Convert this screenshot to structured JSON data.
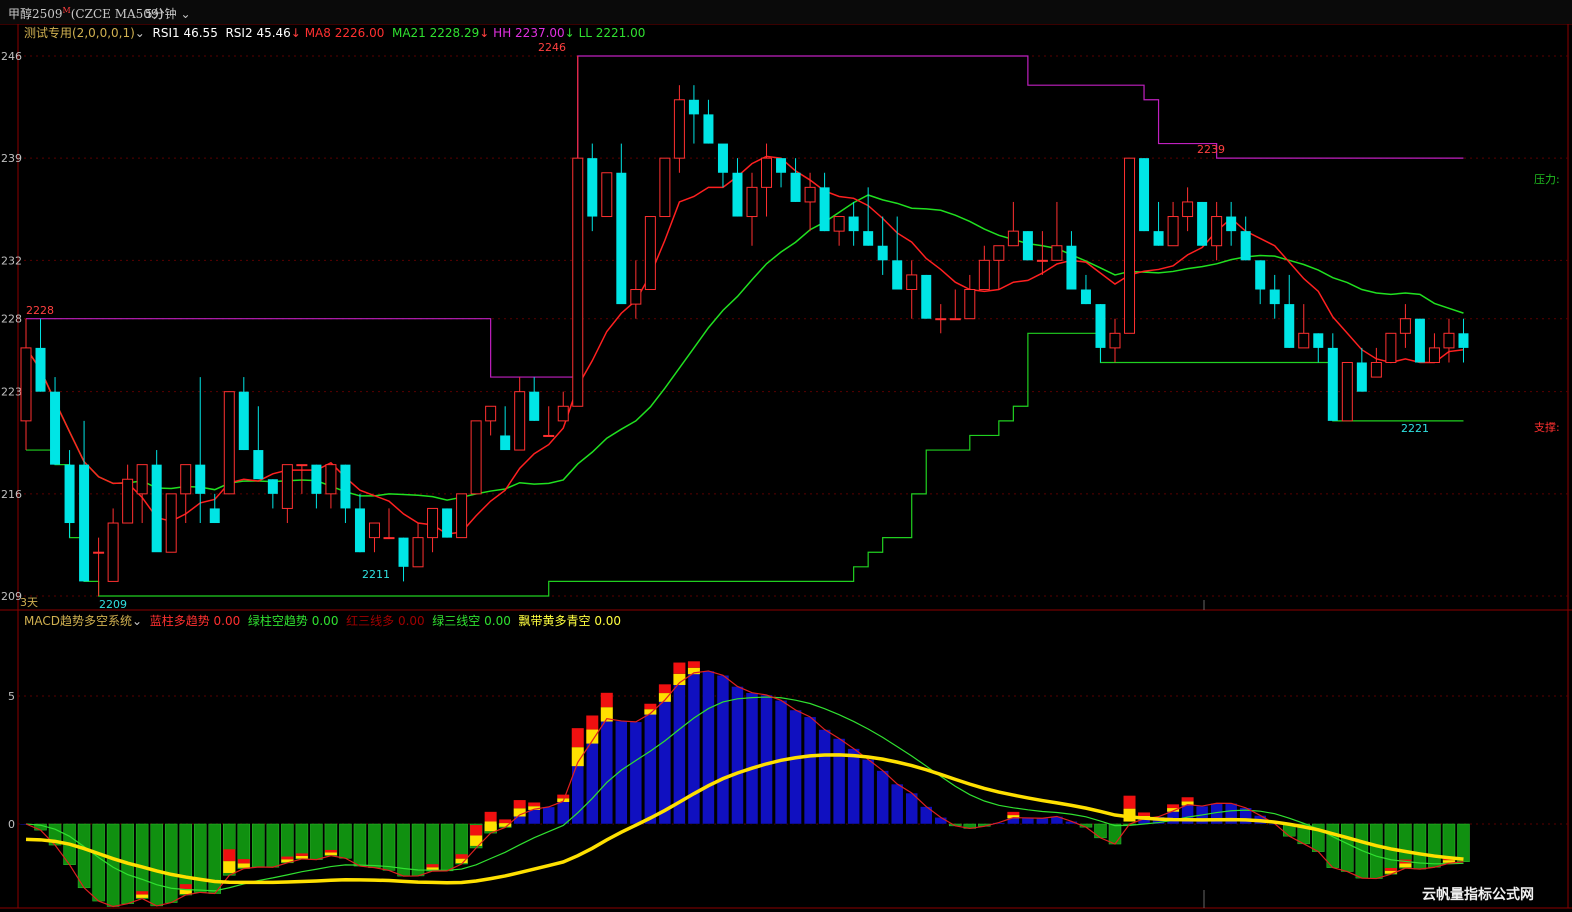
{
  "titlebar": {
    "symbol": "甲醇2509",
    "symbol_sup": "M",
    "contract": "(CZCE MA509)",
    "period": "5分钟"
  },
  "upper": {
    "indicator_name": "测试专用(2,0,0,0,1)",
    "rsi1_label": "RSI1",
    "rsi1": "46.55",
    "rsi2_label": "RSI2",
    "rsi2": "45.46",
    "ma8_label": "MA8",
    "ma8": "2226.00",
    "ma21_label": "MA21",
    "ma21": "2228.29",
    "hh_label": "HH",
    "hh": "2237.00",
    "ll_label": "LL",
    "ll": "2221.00",
    "axis_ticks": [
      "246",
      "239",
      "232",
      "228",
      "223",
      "216",
      "209"
    ],
    "high_marks": [
      "2228",
      "2246",
      "2239"
    ],
    "low_marks": [
      "2209",
      "2211",
      "2221"
    ],
    "pressure_label": "压力:",
    "support_label": "支撑:",
    "days_label": "3天"
  },
  "lower": {
    "indicator_name": "MACD趋势多空系统",
    "blue_label": "蓝柱多趋势",
    "blue_val": "0.00",
    "green_label": "绿柱空趋势",
    "green_val": "0.00",
    "red3_label": "红三线多",
    "red3_val": "0.00",
    "green3_label": "绿三线空",
    "green3_val": "0.00",
    "ribbon_label": "飘带黄多青空",
    "ribbon_val": "0.00",
    "axis_ticks": [
      "5",
      "0"
    ]
  },
  "watermark": "云帆量指标公式网",
  "colors": {
    "up": "#ff3030",
    "down": "#00e5e5",
    "ma8": "#ff2020",
    "ma21": "#20e020",
    "hh": "#c020c0",
    "ll": "#20d020"
  },
  "chart_data": [
    {
      "type": "candlestick",
      "title": "甲醇2509 5分钟",
      "ylim": [
        2209,
        2246
      ],
      "ohlc": [
        [
          2221,
          2228,
          2219,
          2226
        ],
        [
          2226,
          2228,
          2223,
          2223
        ],
        [
          2223,
          2224,
          2218,
          2218
        ],
        [
          2218,
          2219,
          2213,
          2214
        ],
        [
          2218,
          2221,
          2210,
          2210
        ],
        [
          2212,
          2213,
          2209,
          2212
        ],
        [
          2210,
          2215,
          2210,
          2214
        ],
        [
          2214,
          2218,
          2214,
          2217
        ],
        [
          2216,
          2218,
          2214,
          2218
        ],
        [
          2218,
          2219,
          2214,
          2212
        ],
        [
          2212,
          2216,
          2212,
          2216
        ],
        [
          2216,
          2218,
          2214,
          2218
        ],
        [
          2218,
          2224,
          2214,
          2216
        ],
        [
          2215,
          2216,
          2214,
          2214
        ],
        [
          2216,
          2223,
          2216,
          2223
        ],
        [
          2223,
          2224,
          2219,
          2219
        ],
        [
          2219,
          2222,
          2217,
          2217
        ],
        [
          2217,
          2217,
          2215,
          2216
        ],
        [
          2215,
          2218,
          2214,
          2218
        ],
        [
          2218,
          2218,
          2216,
          2218
        ],
        [
          2218,
          2218,
          2215,
          2216
        ],
        [
          2216,
          2218,
          2215,
          2218
        ],
        [
          2218,
          2218,
          2214,
          2215
        ],
        [
          2215,
          2216,
          2212,
          2212
        ],
        [
          2213,
          2214,
          2212,
          2214
        ],
        [
          2213,
          2215,
          2213,
          2213
        ],
        [
          2213,
          2213,
          2210,
          2211
        ],
        [
          2211,
          2214,
          2211,
          2213
        ],
        [
          2213,
          2215,
          2212,
          2215
        ],
        [
          2215,
          2215,
          2213,
          2213
        ],
        [
          2213,
          2216,
          2213,
          2216
        ],
        [
          2216,
          2220,
          2216,
          2221
        ],
        [
          2221,
          2222,
          2220,
          2222
        ],
        [
          2220,
          2222,
          2220,
          2219
        ],
        [
          2219,
          2224,
          2219,
          2223
        ],
        [
          2223,
          2224,
          2221,
          2221
        ],
        [
          2220,
          2222,
          2220,
          2220
        ],
        [
          2221,
          2223,
          2221,
          2222
        ],
        [
          2222,
          2246,
          2222,
          2239
        ],
        [
          2239,
          2240,
          2234,
          2235
        ],
        [
          2235,
          2237,
          2235,
          2238
        ],
        [
          2238,
          2240,
          2231,
          2229
        ],
        [
          2229,
          2232,
          2228,
          2230
        ],
        [
          2230,
          2233,
          2230,
          2235
        ],
        [
          2235,
          2239,
          2235,
          2239
        ],
        [
          2239,
          2244,
          2238,
          2243
        ],
        [
          2243,
          2244,
          2240,
          2242
        ],
        [
          2242,
          2243,
          2240,
          2240
        ],
        [
          2240,
          2239,
          2237,
          2238
        ],
        [
          2238,
          2239,
          2235,
          2235
        ],
        [
          2235,
          2238,
          2233,
          2237
        ],
        [
          2237,
          2240,
          2235,
          2239
        ],
        [
          2239,
          2239,
          2237,
          2238
        ],
        [
          2238,
          2239,
          2236,
          2236
        ],
        [
          2236,
          2238,
          2234,
          2237
        ],
        [
          2237,
          2238,
          2234,
          2234
        ],
        [
          2234,
          2235,
          2233,
          2235
        ],
        [
          2235,
          2236,
          2233,
          2234
        ],
        [
          2234,
          2237,
          2233,
          2233
        ],
        [
          2233,
          2235,
          2231,
          2232
        ],
        [
          2232,
          2235,
          2230,
          2230
        ],
        [
          2230,
          2232,
          2228,
          2231
        ],
        [
          2231,
          2231,
          2228,
          2228
        ],
        [
          2228,
          2229,
          2227,
          2228
        ],
        [
          2228,
          2230,
          2228,
          2228
        ],
        [
          2228,
          2231,
          2228,
          2230
        ],
        [
          2230,
          2233,
          2230,
          2232
        ],
        [
          2232,
          2233,
          2230,
          2233
        ],
        [
          2233,
          2236,
          2233,
          2234
        ],
        [
          2234,
          2234,
          2232,
          2232
        ],
        [
          2232,
          2234,
          2231,
          2232
        ],
        [
          2232,
          2236,
          2232,
          2233
        ],
        [
          2233,
          2234,
          2230,
          2230
        ],
        [
          2230,
          2231,
          2229,
          2229
        ],
        [
          2229,
          2229,
          2225,
          2226
        ],
        [
          2226,
          2228,
          2225,
          2227
        ],
        [
          2227,
          2239,
          2227,
          2239
        ],
        [
          2239,
          2239,
          2234,
          2234
        ],
        [
          2234,
          2236,
          2233,
          2233
        ],
        [
          2233,
          2236,
          2233,
          2235
        ],
        [
          2235,
          2237,
          2234,
          2236
        ],
        [
          2236,
          2236,
          2233,
          2233
        ],
        [
          2233,
          2236,
          2232,
          2235
        ],
        [
          2235,
          2236,
          2233,
          2234
        ],
        [
          2234,
          2235,
          2232,
          2232
        ],
        [
          2232,
          2232,
          2229,
          2230
        ],
        [
          2230,
          2231,
          2228,
          2229
        ],
        [
          2229,
          2231,
          2226,
          2226
        ],
        [
          2226,
          2229,
          2226,
          2227
        ],
        [
          2227,
          2227,
          2225,
          2226
        ],
        [
          2226,
          2227,
          2221,
          2221
        ],
        [
          2221,
          2225,
          2221,
          2225
        ],
        [
          2225,
          2226,
          2223,
          2223
        ],
        [
          2224,
          2226,
          2224,
          2225
        ],
        [
          2225,
          2227,
          2225,
          2227
        ],
        [
          2227,
          2229,
          2226,
          2228
        ],
        [
          2228,
          2228,
          2225,
          2225
        ],
        [
          2225,
          2227,
          2225,
          2226
        ],
        [
          2226,
          2228,
          2225,
          2227
        ],
        [
          2227,
          2228,
          2225,
          2226
        ]
      ]
    },
    {
      "type": "bar",
      "title": "MACD趋势多空系统",
      "ylim": [
        -2,
        7
      ]
    }
  ]
}
